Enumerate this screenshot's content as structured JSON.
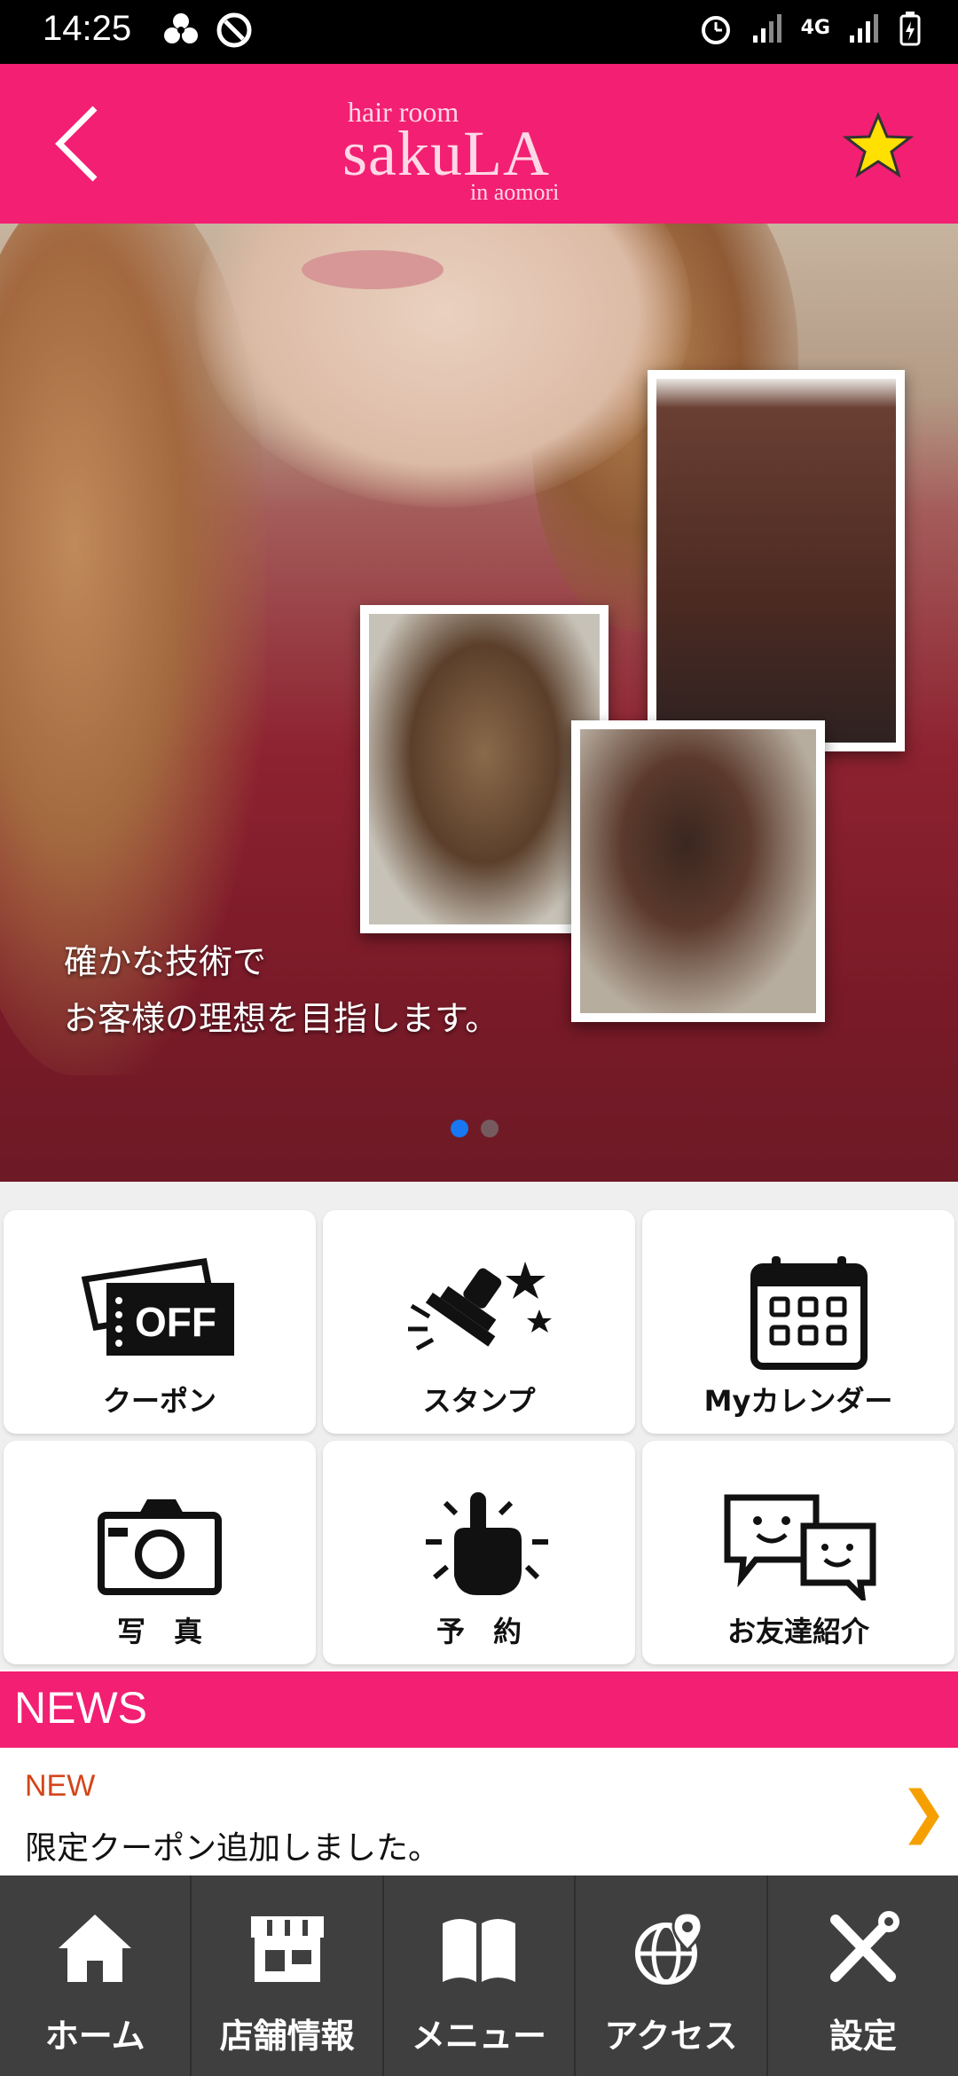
{
  "status_bar": {
    "time": "14:25",
    "network": "4G"
  },
  "header": {
    "logo_top": "hair room",
    "logo_main": "sakuLA",
    "logo_sub": "in aomori",
    "accent_color": "#f21f73"
  },
  "hero": {
    "caption_line1": "確かな技術で",
    "caption_line2": "お客様の理想を目指します。",
    "slide_count": 2,
    "active_slide": 1
  },
  "menu": [
    {
      "label": "クーポン",
      "icon": "coupon-off-icon"
    },
    {
      "label": "スタンプ",
      "icon": "stamp-icon"
    },
    {
      "label": "Myカレンダー",
      "icon": "calendar-icon"
    },
    {
      "label": "写　真",
      "icon": "camera-icon"
    },
    {
      "label": "予　約",
      "icon": "tap-hand-icon"
    },
    {
      "label": "お友達紹介",
      "icon": "chat-friends-icon"
    }
  ],
  "news": {
    "title": "NEWS",
    "items": [
      {
        "badge": "NEW",
        "text": "限定クーポン追加しました。"
      }
    ]
  },
  "bottom_nav": [
    {
      "label": "ホーム",
      "icon": "home-icon"
    },
    {
      "label": "店舗情報",
      "icon": "store-icon"
    },
    {
      "label": "メニュー",
      "icon": "book-icon"
    },
    {
      "label": "アクセス",
      "icon": "globe-pin-icon"
    },
    {
      "label": "設定",
      "icon": "tools-icon"
    }
  ]
}
